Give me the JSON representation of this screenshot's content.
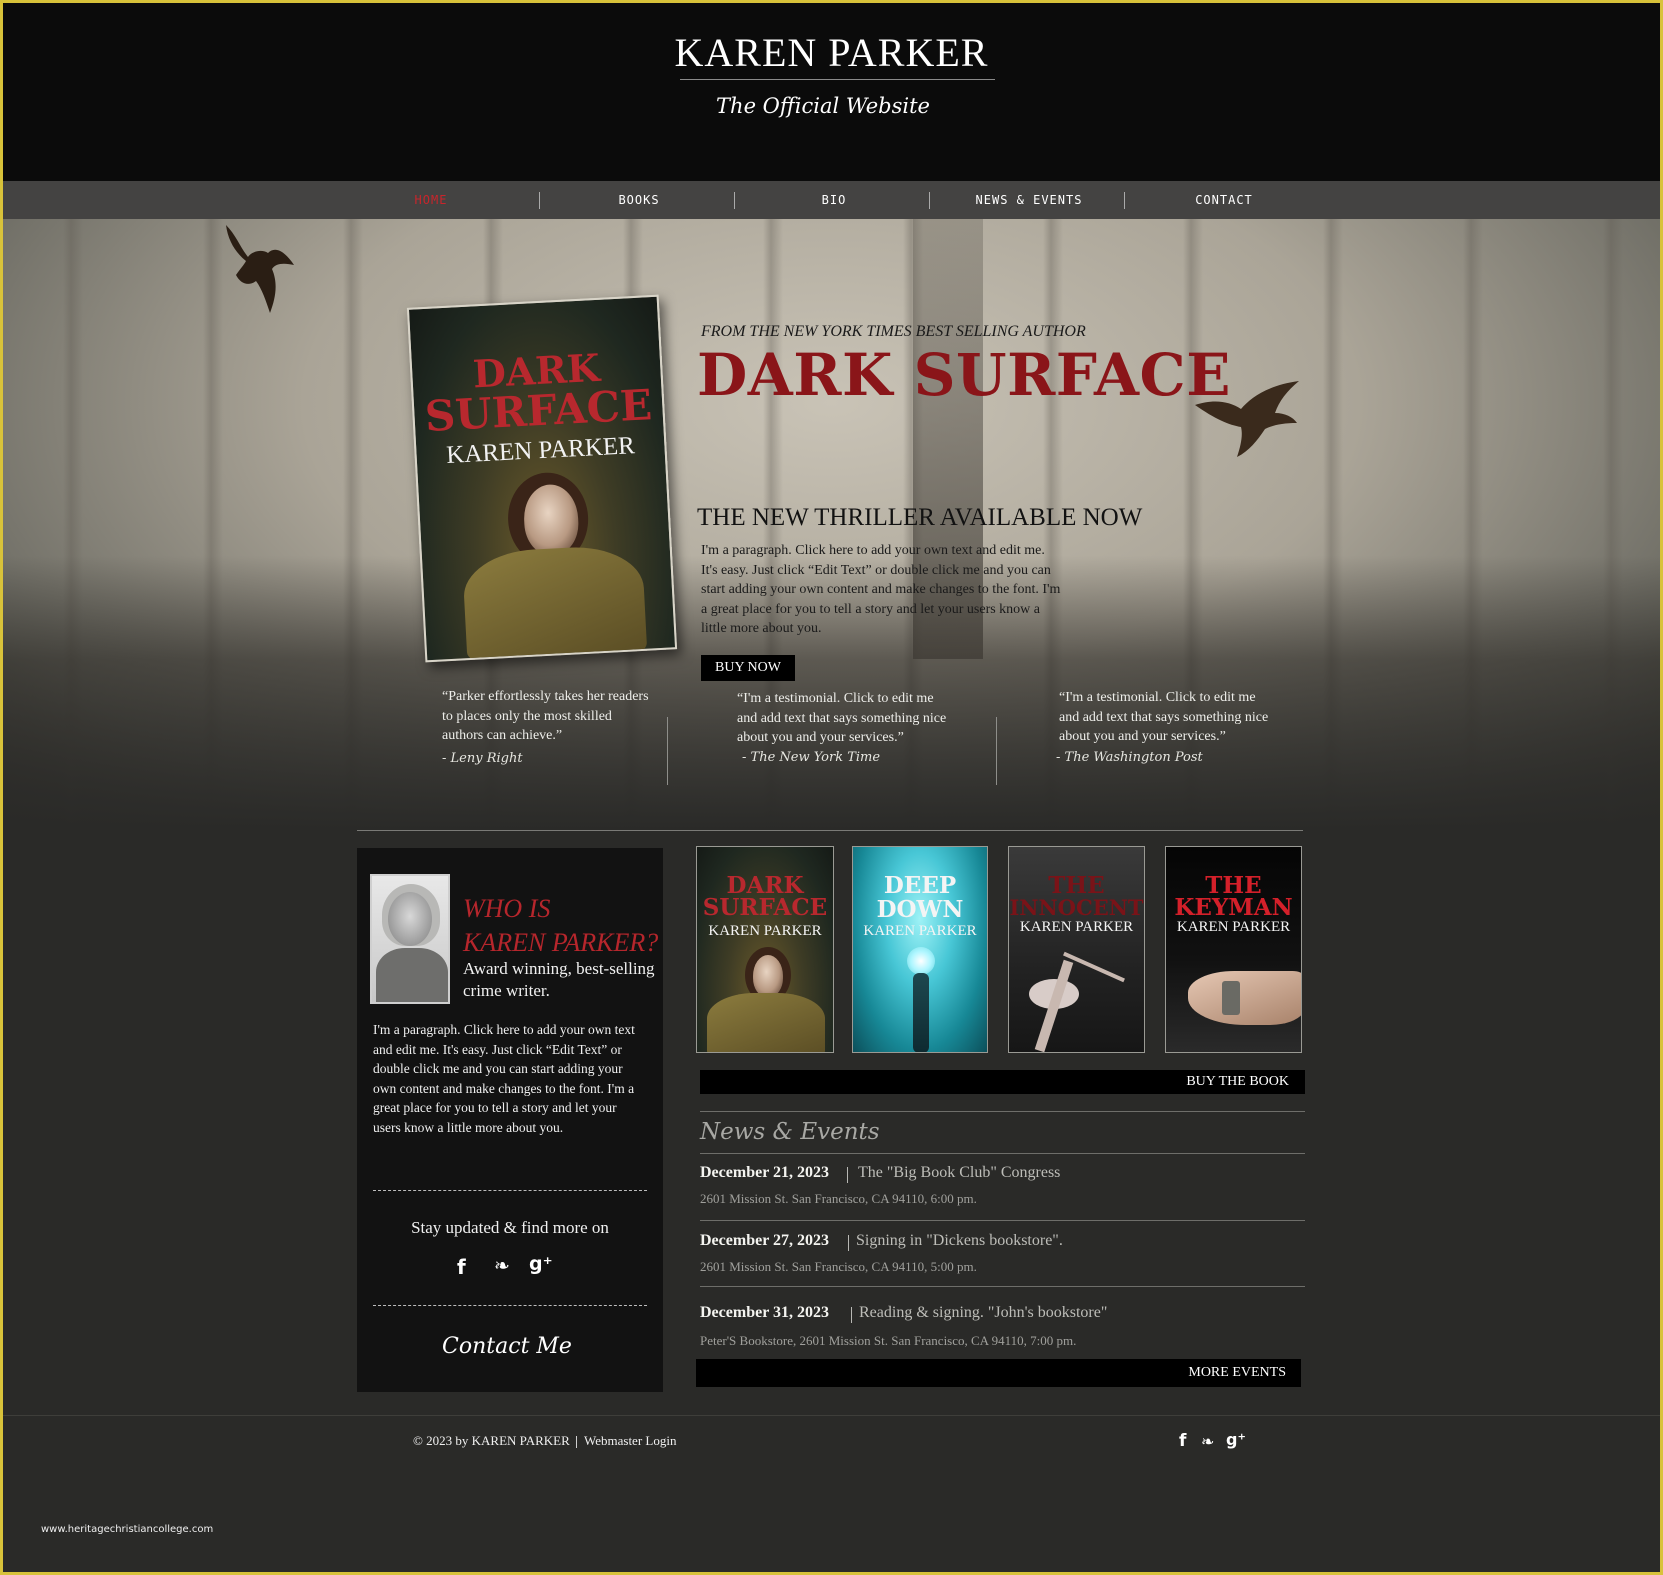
{
  "header": {
    "title": "KAREN PARKER",
    "subtitle": "The Official Website"
  },
  "nav": {
    "items": [
      {
        "label": "HOME",
        "active": true
      },
      {
        "label": "BOOKS",
        "active": false
      },
      {
        "label": "BIO",
        "active": false
      },
      {
        "label": "NEWS & EVENTS",
        "active": false
      },
      {
        "label": "CONTACT",
        "active": false
      }
    ]
  },
  "hero": {
    "cover": {
      "title_line1": "DARK",
      "title_line2": "SURFACE",
      "author": "KAREN PARKER"
    },
    "kicker": "FROM THE NEW YORK TIMES BEST SELLING AUTHOR",
    "title": "DARK SURFACE",
    "subtitle": "THE NEW THRILLER AVAILABLE NOW",
    "paragraph": "I'm a paragraph. Click here to add your own text and edit me. It's easy. Just click “Edit Text” or double click me and you can start adding your own content and make changes to the font. I'm a great place for you to tell a story and let your users know a little more about you.",
    "buy_now_label": "BUY NOW"
  },
  "testimonials": [
    {
      "quote": "“Parker effortlessly takes her readers to places only the most skilled authors can achieve.”",
      "author": "- Leny Right"
    },
    {
      "quote": "“I'm a testimonial. Click to edit me and add text that says something nice about you and your services.”",
      "author": "- The New York Time"
    },
    {
      "quote": "“I'm a testimonial. Click to edit me and add text that says something nice about you and your services.”",
      "author": "- The Washington Post"
    }
  ],
  "bio": {
    "heading_line1": "WHO IS",
    "heading_line2": "KAREN PARKER?",
    "tagline": "Award winning, best-selling crime writer.",
    "paragraph": "I'm a paragraph. Click here to add your own text and edit me. It's easy. Just click “Edit Text” or double click me and you can start adding your own content and make changes to the font. I'm a great place for you to tell a story and let your users know a little more about you.",
    "stay_updated": "Stay updated & find more on",
    "social": {
      "facebook": "f",
      "twitter": "❧",
      "google_plus": "g⁺"
    },
    "contact_label": "Contact Me"
  },
  "books": [
    {
      "title_line1": "DARK",
      "title_line2": "SURFACE",
      "author": "KAREN PARKER",
      "title_color": "#b8282e"
    },
    {
      "title_line1": "DEEP",
      "title_line2": "DOWN",
      "author": "KAREN PARKER",
      "title_color": "#f4f4f4"
    },
    {
      "title_line1": "THE",
      "title_line2": "INNOCENT",
      "author": "KAREN PARKER",
      "title_color": "#7a1318"
    },
    {
      "title_line1": "THE",
      "title_line2": "KEYMAN",
      "author": "KAREN PARKER",
      "title_color": "#d4202a"
    }
  ],
  "buy_book_label": "BUY THE BOOK",
  "news": {
    "heading": "News & Events",
    "events": [
      {
        "date": "December 21, 2023",
        "title": "The \"Big Book Club\" Congress",
        "address": "2601 Mission St. San Francisco, CA 94110, 6:00 pm."
      },
      {
        "date": "December 27, 2023",
        "title": "Signing in \"Dickens bookstore\".",
        "address": "2601 Mission St. San Francisco, CA 94110, 5:00 pm."
      },
      {
        "date": "December 31, 2023",
        "title": "Reading & signing. \"John's bookstore\"",
        "address": "Peter'S Bookstore, 2601 Mission St. San Francisco, CA 94110, 7:00 pm."
      }
    ],
    "more_events_label": "MORE EVENTS"
  },
  "footer": {
    "copyright": "© 2023 by KAREN PARKER",
    "webmaster_login": "Webmaster Login",
    "social": {
      "facebook": "f",
      "twitter": "❧",
      "google_plus": "g⁺"
    }
  },
  "watermark": "www.heritagechristiancollege.com",
  "colors": {
    "accent_red": "#8a1519",
    "nav_active": "#c8252b",
    "frame_border": "#d8c23a"
  }
}
